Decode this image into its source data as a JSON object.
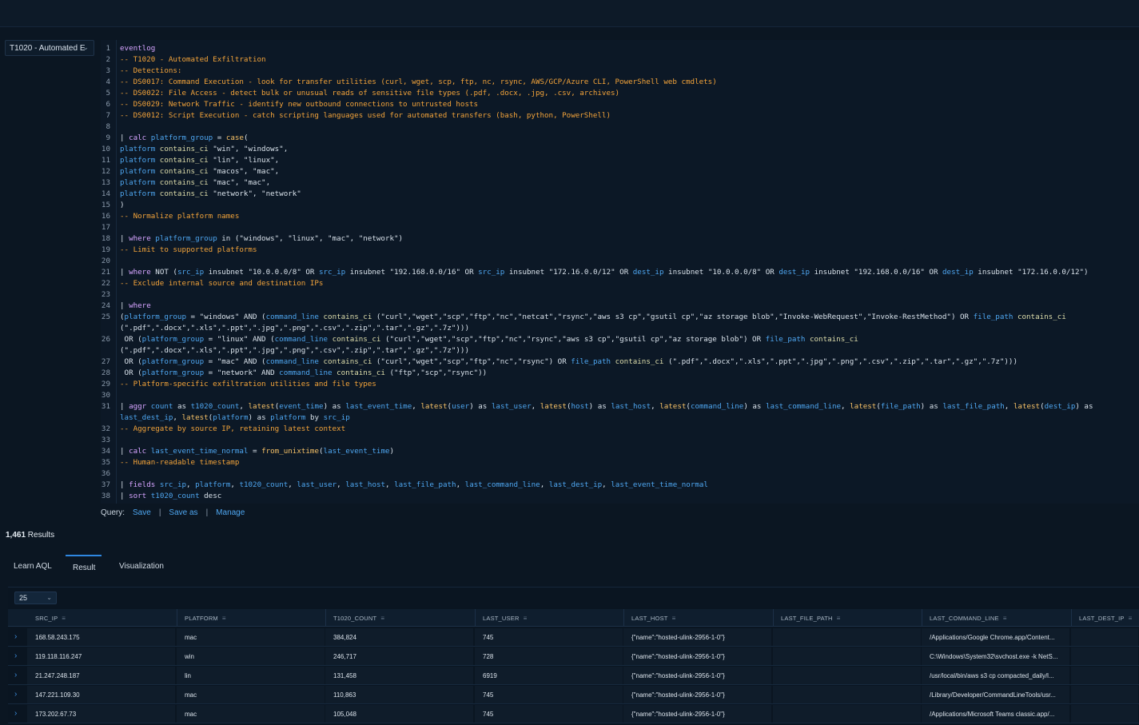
{
  "query_selector": {
    "value": "T1020 - Automated E"
  },
  "editor": {
    "lines": [
      [
        [
          "kw",
          "eventlog"
        ]
      ],
      [
        [
          "cm",
          "-- T1020 - Automated Exfiltration"
        ]
      ],
      [
        [
          "cm",
          "-- Detections:"
        ]
      ],
      [
        [
          "cm",
          "-- DS0017: Command Execution - look for transfer utilities (curl, wget, scp, ftp, nc, rsync, AWS/GCP/Azure CLI, PowerShell web cmdlets)"
        ]
      ],
      [
        [
          "cm",
          "-- DS0022: File Access - detect bulk or unusual reads of sensitive file types (.pdf, .docx, .jpg, .csv, archives)"
        ]
      ],
      [
        [
          "cm",
          "-- DS0029: Network Traffic - identify new outbound connections to untrusted hosts"
        ]
      ],
      [
        [
          "cm",
          "-- DS0012: Script Execution - catch scripting languages used for automated transfers (bash, python, PowerShell)"
        ]
      ],
      [],
      [
        [
          "pl",
          "| "
        ],
        [
          "kw",
          "calc "
        ],
        [
          "fld",
          "platform_group"
        ],
        [
          "pl",
          " = "
        ],
        [
          "fn",
          "case"
        ],
        [
          "pl",
          "("
        ]
      ],
      [
        [
          "fld",
          "platform "
        ],
        [
          "op",
          "contains_ci"
        ],
        [
          "str",
          " \"win\", \"windows\","
        ]
      ],
      [
        [
          "fld",
          "platform "
        ],
        [
          "op",
          "contains_ci"
        ],
        [
          "str",
          " \"lin\", \"linux\","
        ]
      ],
      [
        [
          "fld",
          "platform "
        ],
        [
          "op",
          "contains_ci"
        ],
        [
          "str",
          " \"macos\", \"mac\","
        ]
      ],
      [
        [
          "fld",
          "platform "
        ],
        [
          "op",
          "contains_ci"
        ],
        [
          "str",
          " \"mac\", \"mac\","
        ]
      ],
      [
        [
          "fld",
          "platform "
        ],
        [
          "op",
          "contains_ci"
        ],
        [
          "str",
          " \"network\", \"network\""
        ]
      ],
      [
        [
          "pl",
          ")"
        ]
      ],
      [
        [
          "cm",
          "-- Normalize platform names"
        ]
      ],
      [],
      [
        [
          "pl",
          "| "
        ],
        [
          "kw",
          "where "
        ],
        [
          "fld",
          "platform_group"
        ],
        [
          "pl",
          " in (\"windows\", \"linux\", \"mac\", \"network\")"
        ]
      ],
      [
        [
          "cm",
          "-- Limit to supported platforms"
        ]
      ],
      [],
      [
        [
          "pl",
          "| "
        ],
        [
          "kw",
          "where "
        ],
        [
          "pl",
          "NOT ("
        ],
        [
          "fld",
          "src_ip"
        ],
        [
          "pl",
          " insubnet \"10.0.0.0/8\" OR "
        ],
        [
          "fld",
          "src_ip"
        ],
        [
          "pl",
          " insubnet \"192.168.0.0/16\" OR "
        ],
        [
          "fld",
          "src_ip"
        ],
        [
          "pl",
          " insubnet \"172.16.0.0/12\" OR "
        ],
        [
          "fld",
          "dest_ip"
        ],
        [
          "pl",
          " insubnet \"10.0.0.0/8\" OR "
        ],
        [
          "fld",
          "dest_ip"
        ],
        [
          "pl",
          " insubnet \"192.168.0.0/16\" OR "
        ],
        [
          "fld",
          "dest_ip"
        ],
        [
          "pl",
          " insubnet \"172.16.0.0/12\")"
        ]
      ],
      [
        [
          "cm",
          "-- Exclude internal source and destination IPs"
        ]
      ],
      [],
      [
        [
          "pl",
          "| "
        ],
        [
          "kw",
          "where"
        ]
      ],
      [
        [
          "pl",
          "("
        ],
        [
          "fld",
          "platform_group"
        ],
        [
          "pl",
          " = \"windows\" AND ("
        ],
        [
          "fld",
          "command_line"
        ],
        [
          "op",
          " contains_ci"
        ],
        [
          "pl",
          " (\"curl\",\"wget\",\"scp\",\"ftp\",\"nc\",\"netcat\",\"rsync\",\"aws s3 cp\",\"gsutil cp\",\"az storage blob\",\"Invoke-WebRequest\",\"Invoke-RestMethod\") OR "
        ],
        [
          "fld",
          "file_path"
        ],
        [
          "op",
          " contains_ci"
        ]
      ],
      [
        [
          "pl",
          "(\".pdf\",\".docx\",\".xls\",\".ppt\",\".jpg\",\".png\",\".csv\",\".zip\",\".tar\",\".gz\",\".7z\")))"
        ]
      ],
      [
        [
          "pl",
          " OR ("
        ],
        [
          "fld",
          "platform_group"
        ],
        [
          "pl",
          " = \"linux\" AND ("
        ],
        [
          "fld",
          "command_line"
        ],
        [
          "op",
          " contains_ci"
        ],
        [
          "pl",
          " (\"curl\",\"wget\",\"scp\",\"ftp\",\"nc\",\"rsync\",\"aws s3 cp\",\"gsutil cp\",\"az storage blob\") OR "
        ],
        [
          "fld",
          "file_path"
        ],
        [
          "op",
          " contains_ci"
        ]
      ],
      [
        [
          "pl",
          "(\".pdf\",\".docx\",\".xls\",\".ppt\",\".jpg\",\".png\",\".csv\",\".zip\",\".tar\",\".gz\",\".7z\")))"
        ]
      ],
      [
        [
          "pl",
          " OR ("
        ],
        [
          "fld",
          "platform_group"
        ],
        [
          "pl",
          " = \"mac\" AND ("
        ],
        [
          "fld",
          "command_line"
        ],
        [
          "op",
          " contains_ci"
        ],
        [
          "pl",
          " (\"curl\",\"wget\",\"scp\",\"ftp\",\"nc\",\"rsync\") OR "
        ],
        [
          "fld",
          "file_path"
        ],
        [
          "op",
          " contains_ci"
        ],
        [
          "pl",
          " (\".pdf\",\".docx\",\".xls\",\".ppt\",\".jpg\",\".png\",\".csv\",\".zip\",\".tar\",\".gz\",\".7z\")))"
        ]
      ],
      [
        [
          "pl",
          " OR ("
        ],
        [
          "fld",
          "platform_group"
        ],
        [
          "pl",
          " = \"network\" AND "
        ],
        [
          "fld",
          "command_line"
        ],
        [
          "op",
          " contains_ci"
        ],
        [
          "pl",
          " (\"ftp\",\"scp\",\"rsync\"))"
        ]
      ],
      [
        [
          "cm",
          "-- Platform-specific exfiltration utilities and file types"
        ]
      ],
      [],
      [
        [
          "pl",
          "| "
        ],
        [
          "kw",
          "aggr "
        ],
        [
          "fld",
          "count"
        ],
        [
          "pl",
          " as "
        ],
        [
          "fld",
          "t1020_count"
        ],
        [
          "pl",
          ", "
        ],
        [
          "fn",
          "latest"
        ],
        [
          "pl",
          "("
        ],
        [
          "fld",
          "event_time"
        ],
        [
          "pl",
          ") as "
        ],
        [
          "fld",
          "last_event_time"
        ],
        [
          "pl",
          ", "
        ],
        [
          "fn",
          "latest"
        ],
        [
          "pl",
          "("
        ],
        [
          "fld",
          "user"
        ],
        [
          "pl",
          ") as "
        ],
        [
          "fld",
          "last_user"
        ],
        [
          "pl",
          ", "
        ],
        [
          "fn",
          "latest"
        ],
        [
          "pl",
          "("
        ],
        [
          "fld",
          "host"
        ],
        [
          "pl",
          ") as "
        ],
        [
          "fld",
          "last_host"
        ],
        [
          "pl",
          ", "
        ],
        [
          "fn",
          "latest"
        ],
        [
          "pl",
          "("
        ],
        [
          "fld",
          "command_line"
        ],
        [
          "pl",
          ") as "
        ],
        [
          "fld",
          "last_command_line"
        ],
        [
          "pl",
          ", "
        ],
        [
          "fn",
          "latest"
        ],
        [
          "pl",
          "("
        ],
        [
          "fld",
          "file_path"
        ],
        [
          "pl",
          ") as "
        ],
        [
          "fld",
          "last_file_path"
        ],
        [
          "pl",
          ", "
        ],
        [
          "fn",
          "latest"
        ],
        [
          "pl",
          "("
        ],
        [
          "fld",
          "dest_ip"
        ],
        [
          "pl",
          ") as"
        ]
      ],
      [
        [
          "fld",
          "last_dest_ip"
        ],
        [
          "pl",
          ", "
        ],
        [
          "fn",
          "latest"
        ],
        [
          "pl",
          "("
        ],
        [
          "fld",
          "platform"
        ],
        [
          "pl",
          ") as "
        ],
        [
          "fld",
          "platform"
        ],
        [
          "pl",
          " by "
        ],
        [
          "fld",
          "src_ip"
        ]
      ],
      [
        [
          "cm",
          "-- Aggregate by source IP, retaining latest context"
        ]
      ],
      [],
      [
        [
          "pl",
          "| "
        ],
        [
          "kw",
          "calc "
        ],
        [
          "fld",
          "last_event_time_normal"
        ],
        [
          "pl",
          " = "
        ],
        [
          "fn",
          "from_unixtime"
        ],
        [
          "pl",
          "("
        ],
        [
          "fld",
          "last_event_time"
        ],
        [
          "pl",
          ")"
        ]
      ],
      [
        [
          "cm",
          "-- Human-readable timestamp"
        ]
      ],
      [],
      [
        [
          "pl",
          "| "
        ],
        [
          "kw",
          "fields "
        ],
        [
          "fld",
          "src_ip"
        ],
        [
          "pl",
          ", "
        ],
        [
          "fld",
          "platform"
        ],
        [
          "pl",
          ", "
        ],
        [
          "fld",
          "t1020_count"
        ],
        [
          "pl",
          ", "
        ],
        [
          "fld",
          "last_user"
        ],
        [
          "pl",
          ", "
        ],
        [
          "fld",
          "last_host"
        ],
        [
          "pl",
          ", "
        ],
        [
          "fld",
          "last_file_path"
        ],
        [
          "pl",
          ", "
        ],
        [
          "fld",
          "last_command_line"
        ],
        [
          "pl",
          ", "
        ],
        [
          "fld",
          "last_dest_ip"
        ],
        [
          "pl",
          ", "
        ],
        [
          "fld",
          "last_event_time_normal"
        ]
      ],
      [
        [
          "pl",
          "| "
        ],
        [
          "kw",
          "sort "
        ],
        [
          "fld",
          "t1020_count"
        ],
        [
          "pl",
          " desc"
        ]
      ]
    ],
    "line_numbers": [
      "1",
      "2",
      "3",
      "4",
      "5",
      "6",
      "7",
      "8",
      "9",
      "10",
      "11",
      "12",
      "13",
      "14",
      "15",
      "16",
      "17",
      "18",
      "19",
      "20",
      "21",
      "22",
      "23",
      "24",
      "25",
      "",
      "26",
      "",
      "27",
      "28",
      "29",
      "30",
      "31",
      "",
      "32",
      "33",
      "34",
      "35",
      "36",
      "37",
      "38"
    ]
  },
  "query_actions": {
    "label": "Query:",
    "save": "Save",
    "save_as": "Save as",
    "manage": "Manage",
    "separator": "|"
  },
  "results": {
    "count": "1,461",
    "suffix": " Results"
  },
  "tabs": [
    {
      "label": "Learn AQL",
      "active": false
    },
    {
      "label": "Result",
      "active": true
    },
    {
      "label": "Visualization",
      "active": false
    }
  ],
  "page_size": {
    "value": "25"
  },
  "table": {
    "columns": [
      "SRC_IP",
      "PLATFORM",
      "T1020_COUNT",
      "LAST_USER",
      "LAST_HOST",
      "LAST_FILE_PATH",
      "LAST_COMMAND_LINE",
      "LAST_DEST_IP"
    ],
    "rows": [
      [
        "168.58.243.175",
        "mac",
        "384,824",
        "745",
        "{\"name\":\"hosted-ulink-2956-1-0\"}",
        "",
        "/Applications/Google Chrome.app/Content...",
        ""
      ],
      [
        "119.118.116.247",
        "win",
        "246,717",
        "728",
        "{\"name\":\"hosted-ulink-2956-1-0\"}",
        "",
        "C:\\Windows\\System32\\svchost.exe -k NetS...",
        ""
      ],
      [
        "21.247.248.187",
        "lin",
        "131,458",
        "6919",
        "{\"name\":\"hosted-ulink-2956-1-0\"}",
        "",
        "/usr/local/bin/aws s3 cp compacted_daily/l...",
        ""
      ],
      [
        "147.221.109.30",
        "mac",
        "110,863",
        "745",
        "{\"name\":\"hosted-ulink-2956-1-0\"}",
        "",
        "/Library/Developer/CommandLineTools/usr...",
        ""
      ],
      [
        "173.202.67.73",
        "mac",
        "105,048",
        "745",
        "{\"name\":\"hosted-ulink-2956-1-0\"}",
        "",
        "/Applications/Microsoft Teams classic.app/...",
        ""
      ]
    ]
  },
  "colors": {
    "accent": "#2f87e0",
    "comment": "#f2a33a",
    "field": "#4ea6f0",
    "keyword": "#d6a4ff",
    "background": "#0b1622"
  }
}
